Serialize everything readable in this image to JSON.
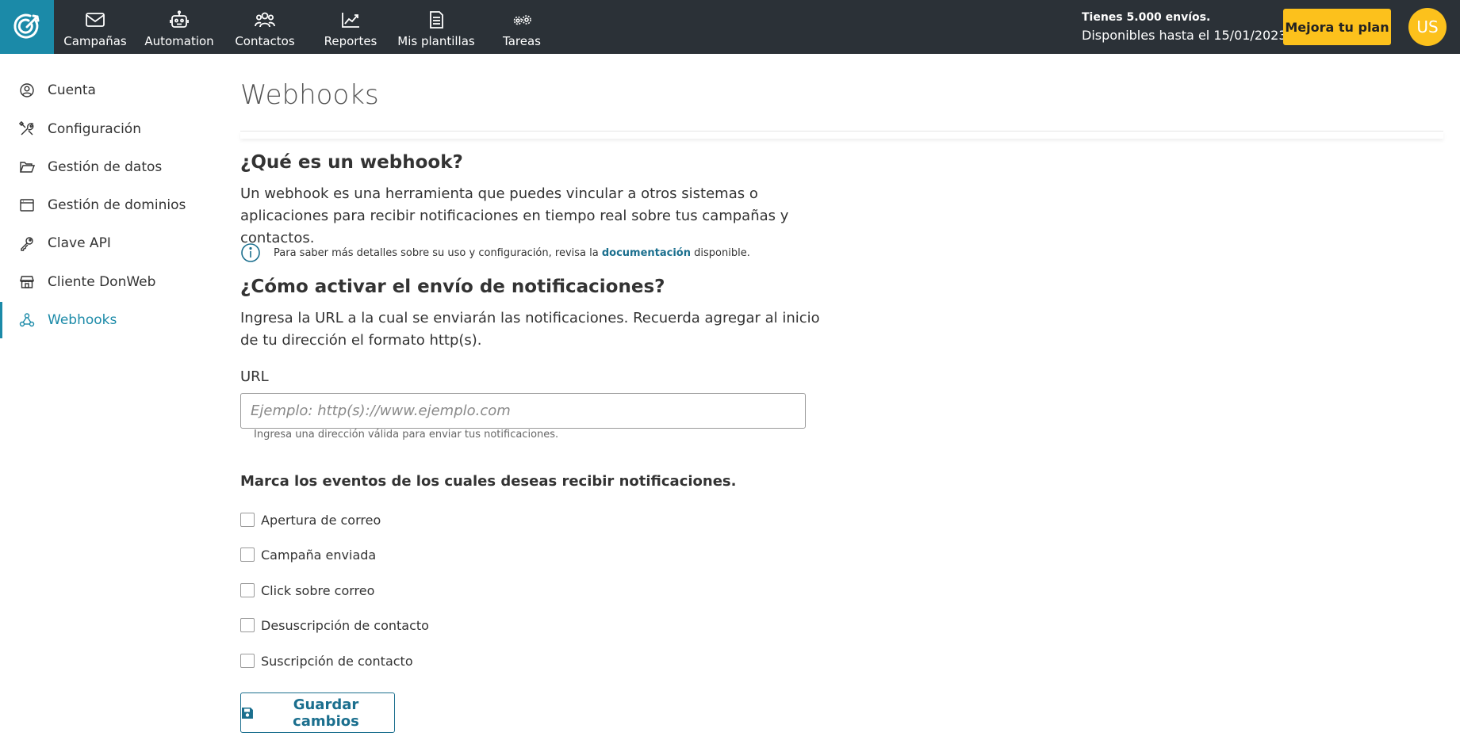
{
  "topbar": {
    "logo_icon": "target-arrow-icon",
    "nav": [
      {
        "label": "Campañas",
        "icon": "envelope-icon"
      },
      {
        "label": "Automation",
        "icon": "robot-icon"
      },
      {
        "label": "Contactos",
        "icon": "users-icon"
      },
      {
        "label": "Reportes",
        "icon": "chart-icon"
      },
      {
        "label": "Mis plantillas",
        "icon": "template-icon"
      },
      {
        "label": "Tareas",
        "icon": "gears-icon"
      }
    ],
    "plan_line1": "Tienes 5.000 envíos.",
    "plan_line2": "Disponibles hasta el 15/01/2023",
    "upgrade_label": "Mejora tu plan",
    "avatar_initials": "US",
    "colors": {
      "bar": "#2b3137",
      "logo": "#1b8aa8",
      "accent": "#fcc11c"
    }
  },
  "sidebar": {
    "items": [
      {
        "label": "Cuenta",
        "icon": "user-circle-icon"
      },
      {
        "label": "Configuración",
        "icon": "tools-icon"
      },
      {
        "label": "Gestión de datos",
        "icon": "folder-icon"
      },
      {
        "label": "Gestión de dominios",
        "icon": "browser-window-icon"
      },
      {
        "label": "Clave API",
        "icon": "key-icon"
      },
      {
        "label": "Cliente DonWeb",
        "icon": "store-icon"
      },
      {
        "label": "Webhooks",
        "icon": "webhook-icon",
        "active": true
      }
    ],
    "active_color": "#1b8aa8"
  },
  "main": {
    "title": "Webhooks",
    "what_heading": "¿Qué es un webhook?",
    "what_text": "Un webhook es una herramienta que puedes vincular a otros sistemas o aplicaciones para recibir notificaciones en tiempo real sobre tus campañas y contactos.",
    "info_before": "Para saber más detalles sobre su uso y configuración, revisa la ",
    "info_link": "documentación",
    "info_after": " disponible.",
    "how_heading": "¿Cómo activar el envío de notificaciones?",
    "how_text": "Ingresa la URL a la cual se enviarán las notificaciones. Recuerda agregar al inicio de tu dirección el formato http(s).",
    "url_label": "URL",
    "url_placeholder": "Ejemplo: http(s)://www.ejemplo.com",
    "url_value": "",
    "url_help": "Ingresa una dirección válida para enviar tus notificaciones.",
    "events_title": "Marca los eventos de los cuales deseas recibir notificaciones.",
    "events": [
      {
        "label": "Apertura de correo",
        "checked": false
      },
      {
        "label": "Campaña enviada",
        "checked": false
      },
      {
        "label": "Click sobre correo",
        "checked": false
      },
      {
        "label": "Desuscripción de contacto",
        "checked": false
      },
      {
        "label": "Suscripción de contacto",
        "checked": false
      }
    ],
    "save_label": "Guardar cambios",
    "save_icon": "floppy-disk-icon",
    "link_color": "#1b6f8e"
  }
}
